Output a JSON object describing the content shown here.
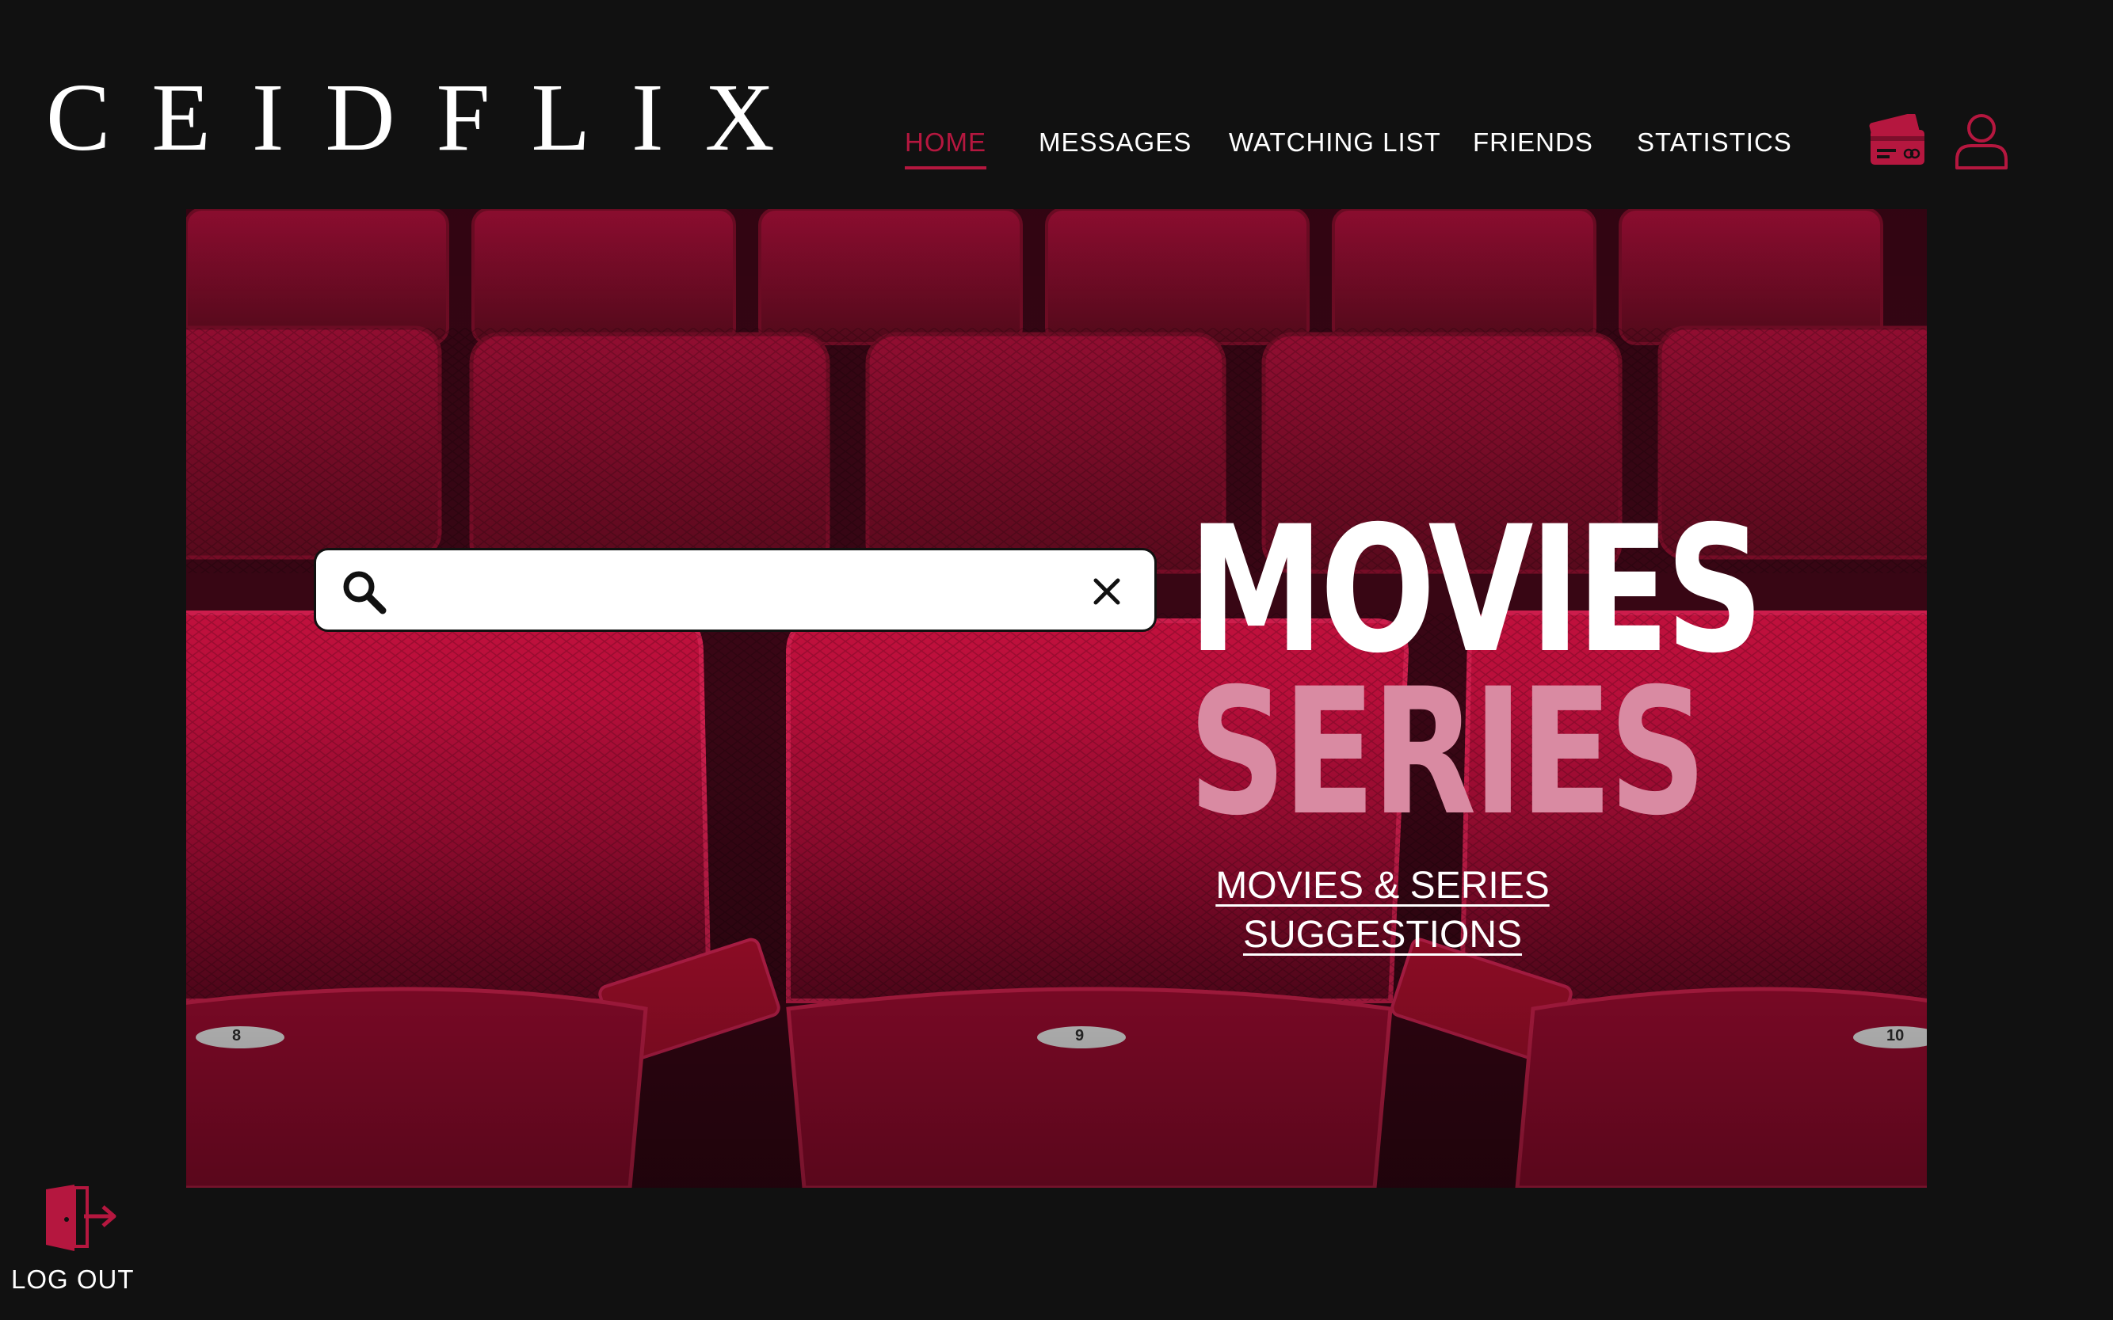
{
  "brand": {
    "logo_text": "CEIDFLIX"
  },
  "nav": {
    "items": [
      {
        "label": "HOME",
        "active": true
      },
      {
        "label": "MESSAGES",
        "active": false
      },
      {
        "label": "WATCHING LIST",
        "active": false
      },
      {
        "label": "FRIENDS",
        "active": false
      },
      {
        "label": "STATISTICS",
        "active": false
      }
    ]
  },
  "header_icons": {
    "payment": "credit-card-icon",
    "profile": "user-icon"
  },
  "hero": {
    "headline_1": "MOVIES",
    "headline_2": "SERIES",
    "link_line_1": "MOVIES & SERIES",
    "link_line_2": "SUGGESTIONS",
    "seat_numbers": [
      "8",
      "9",
      "10"
    ]
  },
  "search": {
    "value": "",
    "placeholder": ""
  },
  "logout": {
    "label": "LOG OUT"
  },
  "colors": {
    "accent": "#b5173f",
    "background": "#111111",
    "series_pink": "#d98aa2"
  }
}
